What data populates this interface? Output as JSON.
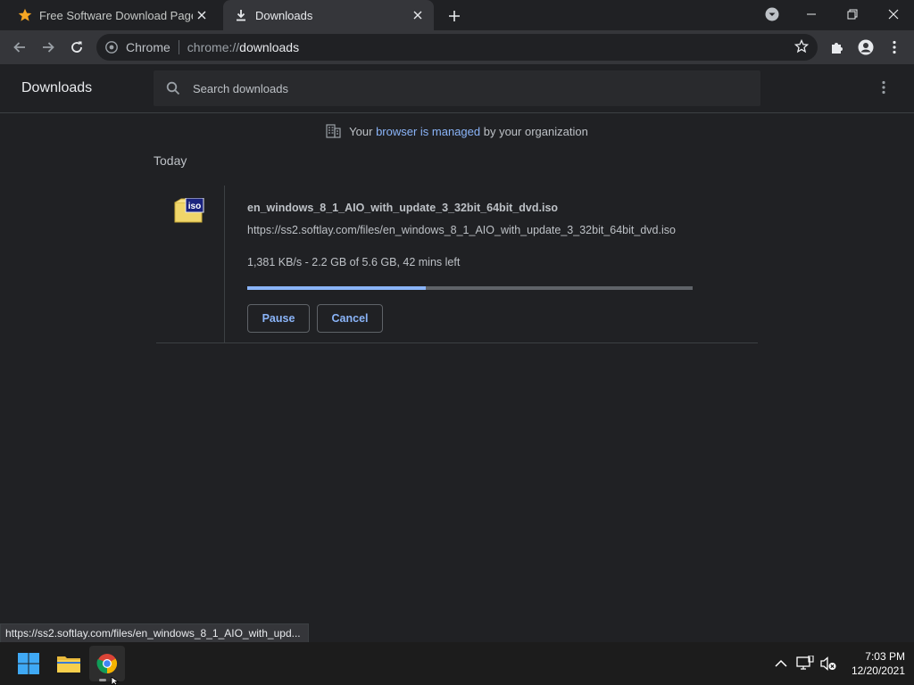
{
  "tabs": [
    {
      "title": "Free Software Download Page - S",
      "favicon": "star-icon",
      "active": false
    },
    {
      "title": "Downloads",
      "favicon": "download-icon",
      "active": true
    }
  ],
  "toolbar": {
    "site_chip": "Chrome",
    "url_scheme": "chrome://",
    "url_host": "downloads"
  },
  "downloads": {
    "heading": "Downloads",
    "search_placeholder": "Search downloads",
    "managed_prefix": "Your ",
    "managed_link": "browser is managed",
    "managed_suffix": " by your organization",
    "section_label": "Today",
    "item": {
      "filename": "en_windows_8_1_AIO_with_update_3_32bit_64bit_dvd.iso",
      "url": "https://ss2.softlay.com/files/en_windows_8_1_AIO_with_update_3_32bit_64bit_dvd.iso",
      "status": "1,381 KB/s - 2.2 GB of 5.6 GB, 42 mins left",
      "progress_fraction": 0.4,
      "icon_label": "iso",
      "pause_label": "Pause",
      "cancel_label": "Cancel"
    }
  },
  "status_bubble": "https://ss2.softlay.com/files/en_windows_8_1_AIO_with_upd...",
  "taskbar": {
    "apps": [
      "windows-start-icon",
      "file-explorer-icon",
      "chrome-icon"
    ],
    "time": "7:03 PM",
    "date": "12/20/2021"
  },
  "colors": {
    "accent": "#8ab4f8",
    "background": "#202124",
    "toolbar": "#35363a"
  }
}
